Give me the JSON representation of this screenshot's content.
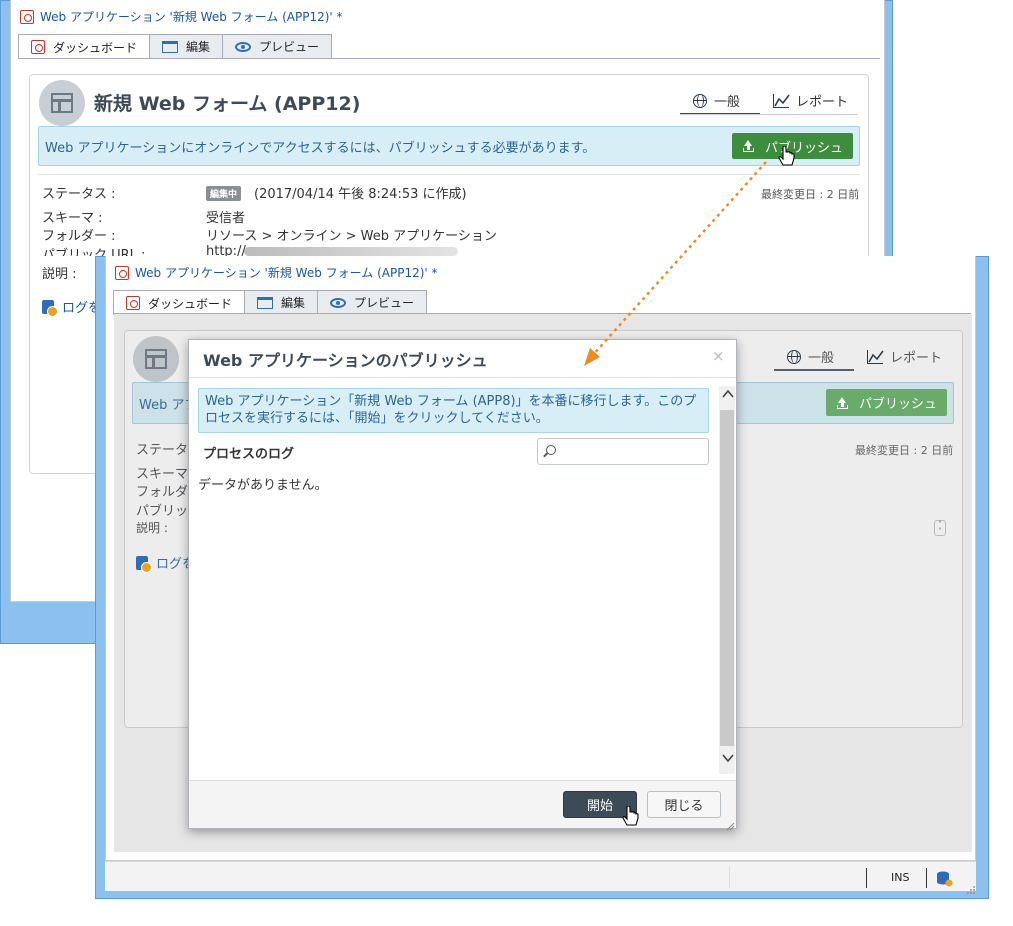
{
  "back_window": {
    "title": "Web アプリケーション '新規 Web フォーム (APP12)' *",
    "tabs": [
      "ダッシュボード",
      "編集",
      "プレビュー"
    ],
    "heading": "新規 Web フォーム (APP12)",
    "view_tabs": [
      "一般",
      "レポート"
    ],
    "banner_text": "Web アプリケーションにオンラインでアクセスするには、パブリッシュする必要があります。",
    "publish_label": "パブリッシュ",
    "fields": {
      "status_label": "ステータス :",
      "status_badge": "編集中",
      "status_value": "(2017/04/14 午後 8:24:53 に作成)",
      "last_modified": "最終変更日 : 2 日前",
      "schema_label": "スキーマ :",
      "schema_value": "受信者",
      "folder_label": "フォルダー :",
      "folder_value": "リソース > オンライン > Web アプリケーション",
      "url_label": "パブリック URL :",
      "url_value": "http://",
      "desc_label": "説明 :",
      "log_label": "ログを"
    }
  },
  "front_window": {
    "title": "Web アプリケーション '新規 Web フォーム (APP12)' *",
    "tabs": [
      "ダッシュボード",
      "編集",
      "プレビュー"
    ],
    "view_tabs": [
      "一般",
      "レポート"
    ],
    "publish_label": "パブリッシュ",
    "bg_fragments": {
      "banner": "Web アプ",
      "status": "ステータ",
      "schema": "スキーマ",
      "folder": "フォルダ",
      "url": "パブリッ",
      "desc": "説明 :",
      "log": "ログを"
    },
    "last_modified": "最終変更日 : 2 日前",
    "statusbar_ins": "INS"
  },
  "dialog": {
    "title": "Web アプリケーションのパブリッシュ",
    "close": "×",
    "info": "Web アプリケーション「新規 Web フォーム (APP8)」を本番に移行します。このプロセスを実行するには、「開始」をクリックしてください。",
    "log_heading": "プロセスのログ",
    "search_placeholder": "",
    "empty_text": "データがありません。",
    "start_label": "開始",
    "close_label": "閉じる"
  },
  "colors": {
    "frame": "#8cc0ee",
    "publish_green": "#3e8c3e",
    "banner_bg": "#d8eef6",
    "dark_button": "#3d4a57",
    "connector": "#f08a24"
  }
}
